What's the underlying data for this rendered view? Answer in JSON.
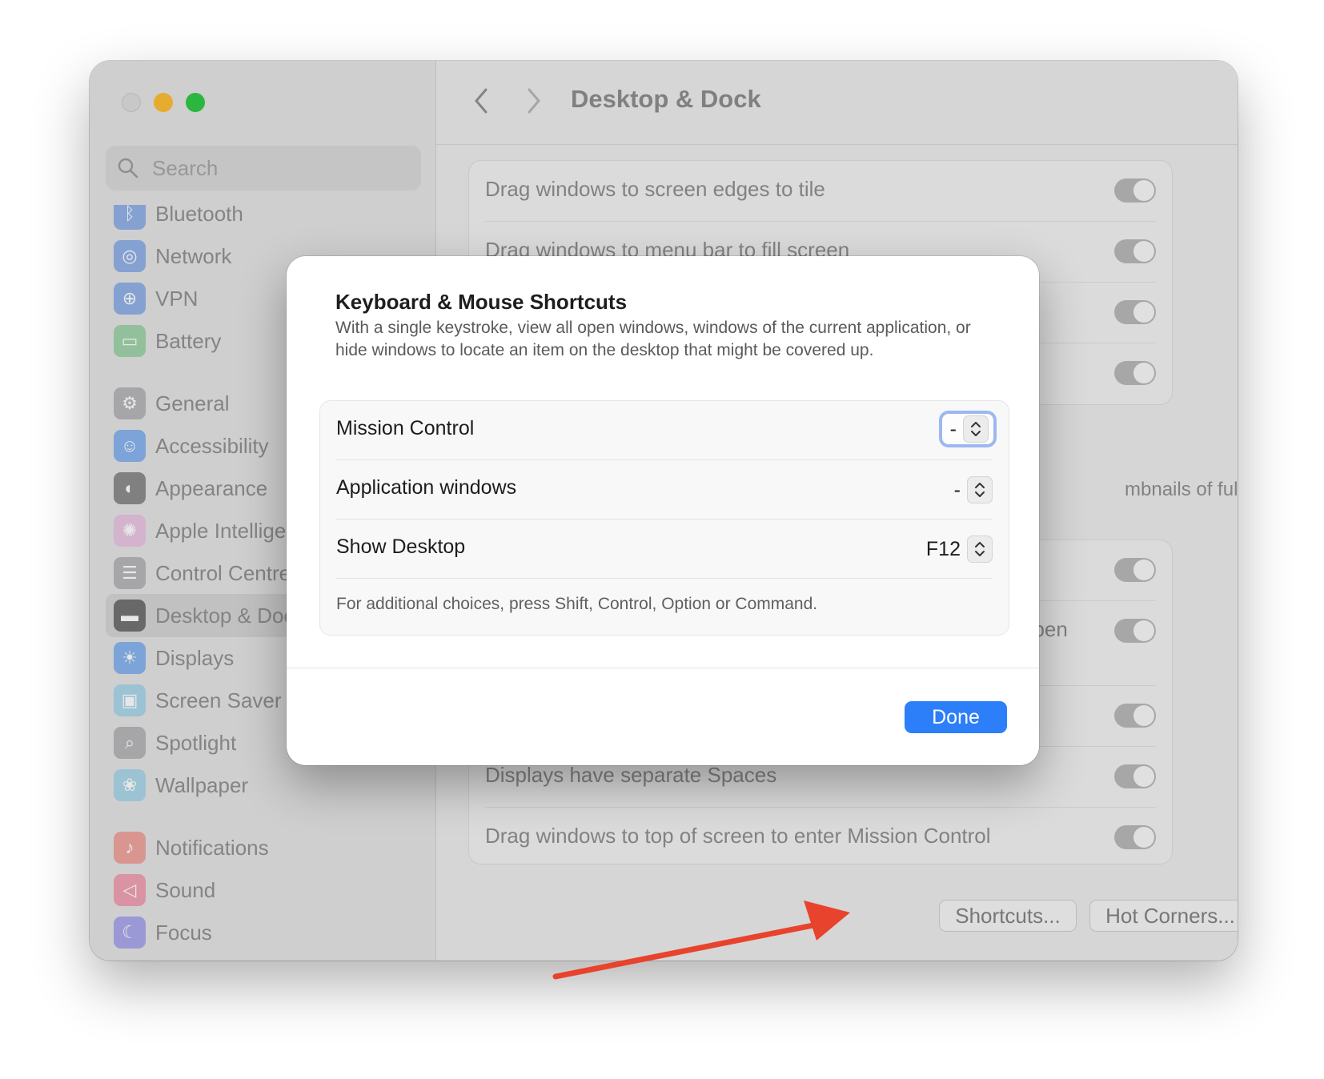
{
  "window": {
    "title": "Desktop & Dock",
    "traffic_lights": [
      "close",
      "minimize",
      "zoom"
    ]
  },
  "sidebar": {
    "search_placeholder": "Search",
    "items": [
      {
        "label": "Bluetooth",
        "icon": "bluetooth-icon",
        "color": "#3b82f6"
      },
      {
        "label": "Network",
        "icon": "globe-icon",
        "color": "#3b82f6"
      },
      {
        "label": "VPN",
        "icon": "vpn-globe-icon",
        "color": "#3b82f6"
      },
      {
        "label": "Battery",
        "icon": "battery-icon",
        "color": "#34c759"
      },
      {
        "label": "General",
        "icon": "gear-icon",
        "color": "#8e8e93"
      },
      {
        "label": "Accessibility",
        "icon": "accessibility-icon",
        "color": "#0a84ff"
      },
      {
        "label": "Appearance",
        "icon": "appearance-icon",
        "color": "#1c1c1e"
      },
      {
        "label": "Apple Intelligence & Siri",
        "icon": "apple-intelligence-icon",
        "color": "#e88bd3"
      },
      {
        "label": "Control Centre",
        "icon": "control-centre-icon",
        "color": "#8e8e93"
      },
      {
        "label": "Desktop & Dock",
        "icon": "desktop-dock-icon",
        "color": "#1c1c1e",
        "selected": true
      },
      {
        "label": "Displays",
        "icon": "sun-icon",
        "color": "#0a84ff"
      },
      {
        "label": "Screen Saver",
        "icon": "screen-saver-icon",
        "color": "#5ac8fa"
      },
      {
        "label": "Spotlight",
        "icon": "magnifier-icon",
        "color": "#8e8e93"
      },
      {
        "label": "Wallpaper",
        "icon": "flower-icon",
        "color": "#5ac8fa"
      },
      {
        "label": "Notifications",
        "icon": "bell-icon",
        "color": "#ff3b30"
      },
      {
        "label": "Sound",
        "icon": "speaker-icon",
        "color": "#ff2d55"
      },
      {
        "label": "Focus",
        "icon": "moon-icon",
        "color": "#5e5ce6"
      }
    ]
  },
  "main": {
    "settings_top": [
      {
        "label": "Drag windows to screen edges to tile",
        "on": true
      },
      {
        "label": "Drag windows to menu bar to fill screen",
        "on": true
      },
      {
        "label": "",
        "on": true
      },
      {
        "label": "",
        "on": true
      }
    ],
    "partial_fragments": {
      "thumbnails": "mbnails of full-",
      "row_e": "e",
      "row_open": "open"
    },
    "settings_bottom": [
      {
        "label": "",
        "on": true
      },
      {
        "label": "",
        "on": true
      },
      {
        "label": "",
        "on": true
      },
      {
        "label": "Displays have separate Spaces",
        "on": true
      },
      {
        "label": "Drag windows to top of screen to enter Mission Control",
        "on": true
      }
    ],
    "buttons": {
      "shortcuts": "Shortcuts...",
      "hot_corners": "Hot Corners...",
      "help": "?"
    }
  },
  "dialog": {
    "title": "Keyboard & Mouse Shortcuts",
    "description": "With a single keystroke, view all open windows, windows of the current application, or hide windows to locate an item on the desktop that might be covered up.",
    "shortcuts": [
      {
        "label": "Mission Control",
        "value": "-",
        "focused": true
      },
      {
        "label": "Application windows",
        "value": "-"
      },
      {
        "label": "Show Desktop",
        "value": "F12"
      }
    ],
    "note": "For additional choices, press Shift, Control, Option or Command.",
    "done_label": "Done"
  },
  "colors": {
    "accent": "#2d7ff9",
    "focus_ring": "#9db8f1",
    "annotation_arrow": "#e8432d"
  }
}
